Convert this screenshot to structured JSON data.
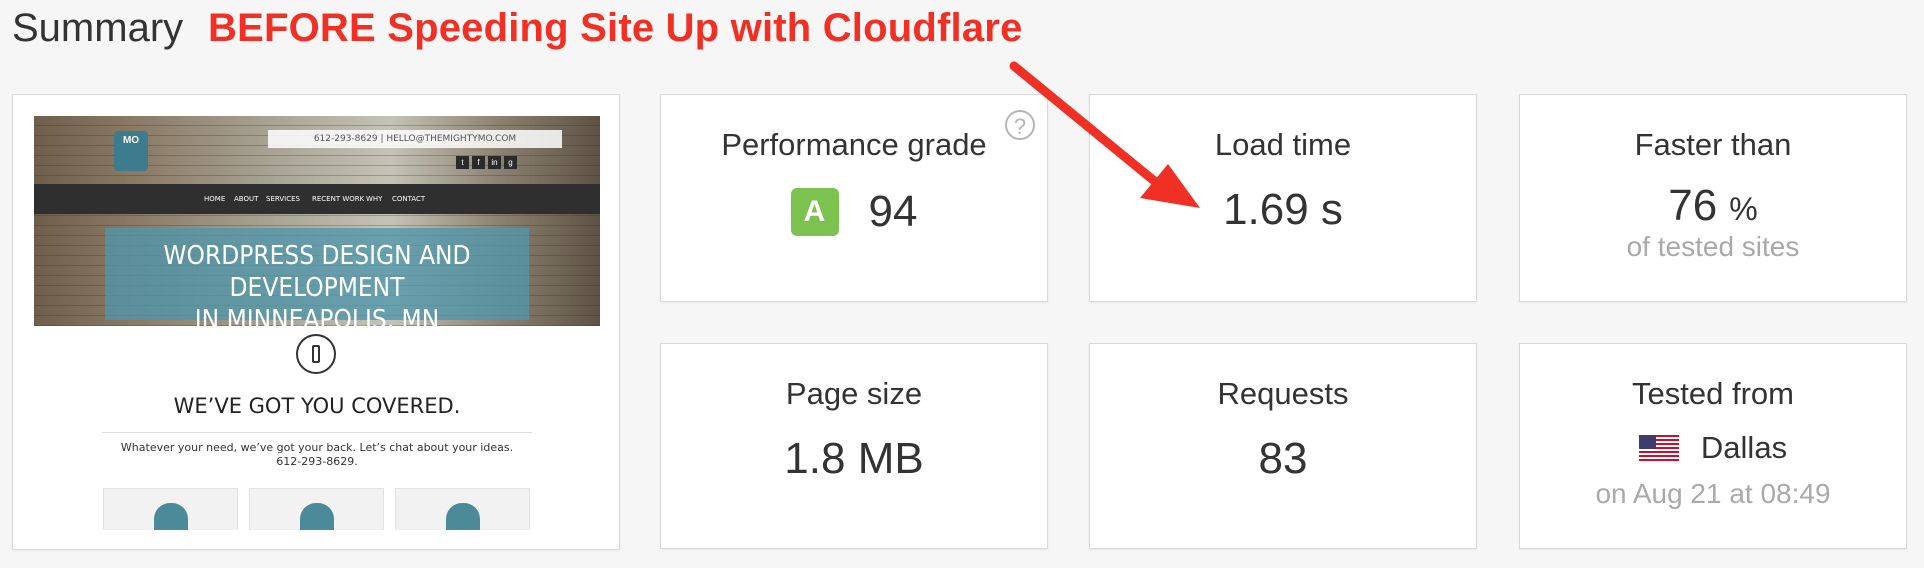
{
  "page": {
    "title": "Summary",
    "annotation": "BEFORE Speeding Site Up with Cloudflare"
  },
  "screenshot": {
    "contact": "612-293-8629 | HELLO@THEMIGHTYMO.COM",
    "nav": [
      "HOME",
      "ABOUT",
      "SERVICES",
      "RECENT WORK",
      "WHY",
      "CONTACT"
    ],
    "hero_line1": "WORDPRESS DESIGN AND DEVELOPMENT",
    "hero_line2": "IN MINNEAPOLIS, MN",
    "covered": "WE’VE GOT YOU COVERED.",
    "blurb_line1": "Whatever your need, we’ve got your back. Let’s chat about your ideas.",
    "blurb_line2": "612-293-8629."
  },
  "metrics": {
    "performance": {
      "label": "Performance grade",
      "grade": "A",
      "score": "94",
      "help": "?"
    },
    "load_time": {
      "label": "Load time",
      "value": "1.69 s"
    },
    "faster": {
      "label": "Faster than",
      "value": "76",
      "unit": "%",
      "sub": "of tested sites"
    },
    "page_size": {
      "label": "Page size",
      "value": "1.8 MB"
    },
    "requests": {
      "label": "Requests",
      "value": "83"
    },
    "tested_from": {
      "label": "Tested from",
      "location": "Dallas",
      "date": "on Aug 21 at 08:49"
    }
  },
  "colors": {
    "annotation": "#f03024",
    "grade_badge": "#7cc24e"
  },
  "icons": {
    "help": "question-circle-icon",
    "flag": "us-flag-icon",
    "arrow": "red-arrow-annotation"
  }
}
